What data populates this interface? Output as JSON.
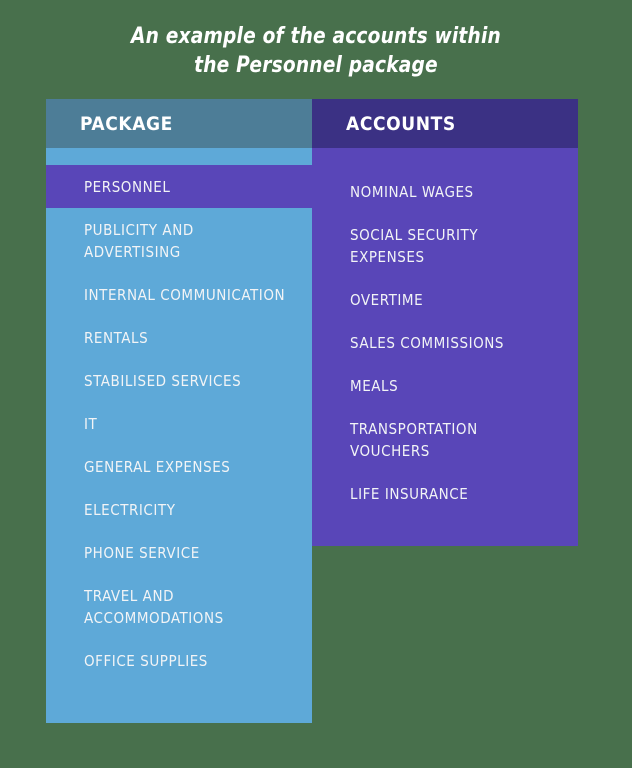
{
  "page": {
    "background_color": "#48704c",
    "title_line1": "An example of the accounts within",
    "title_line2": "the Personnel package"
  },
  "colors": {
    "background_green": "#48704c",
    "package_header": "#4d7d97",
    "package_body": "#5ea9d8",
    "accounts_header": "#3b3184",
    "accounts_body": "#5946b8",
    "highlight_row": "#5946b8",
    "text": "#ffffff"
  },
  "table": {
    "package_column": {
      "header": "PACKAGE",
      "items": [
        {
          "label": "PERSONNEL",
          "highlighted": true
        },
        {
          "label": "PUBLICITY AND\nADVERTISING",
          "highlighted": false
        },
        {
          "label": "INTERNAL COMMUNICATION",
          "highlighted": false
        },
        {
          "label": "RENTALS",
          "highlighted": false
        },
        {
          "label": "STABILISED SERVICES",
          "highlighted": false
        },
        {
          "label": "IT",
          "highlighted": false
        },
        {
          "label": "GENERAL EXPENSES",
          "highlighted": false
        },
        {
          "label": "ELECTRICITY",
          "highlighted": false
        },
        {
          "label": "PHONE SERVICE",
          "highlighted": false
        },
        {
          "label": "TRAVEL AND\nACCOMMODATIONS",
          "highlighted": false
        },
        {
          "label": "OFFICE SUPPLIES",
          "highlighted": false
        }
      ]
    },
    "accounts_column": {
      "header": "ACCOUNTS",
      "items": [
        {
          "label": "NOMINAL WAGES"
        },
        {
          "label": "SOCIAL SECURITY\nEXPENSES"
        },
        {
          "label": "OVERTIME"
        },
        {
          "label": "SALES COMMISSIONS"
        },
        {
          "label": "MEALS"
        },
        {
          "label": "TRANSPORTATION\nVOUCHERS"
        },
        {
          "label": "LIFE INSURANCE"
        }
      ]
    }
  }
}
